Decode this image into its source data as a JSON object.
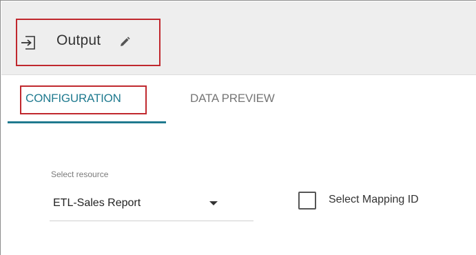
{
  "header": {
    "title": "Output",
    "icons": {
      "node": "output-arrow-icon",
      "edit": "pencil-icon"
    }
  },
  "tabs": [
    {
      "label": "CONFIGURATION",
      "active": true
    },
    {
      "label": "DATA PREVIEW",
      "active": false
    }
  ],
  "form": {
    "resource_label": "Select resource",
    "resource_value": "ETL-Sales Report",
    "mapping_checkbox_label": "Select Mapping ID",
    "mapping_checked": false
  },
  "colors": {
    "accent": "#1f7a8f",
    "highlight_box": "#c0272d",
    "header_bg": "#eeeeee"
  }
}
